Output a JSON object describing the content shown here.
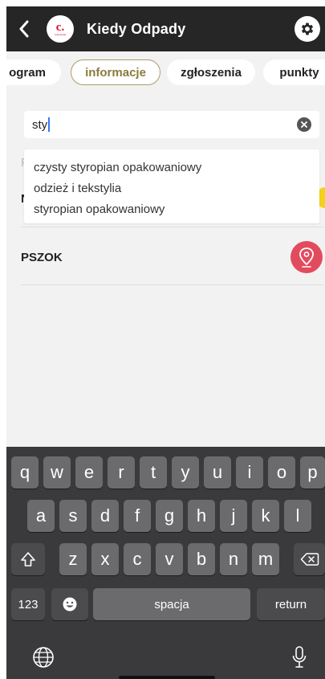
{
  "header": {
    "title": "Kiedy Odpady",
    "logo_text": "c.",
    "logo_sub": "cyklopedia"
  },
  "tabs": [
    {
      "label": "ogram",
      "active": false
    },
    {
      "label": "informacje",
      "active": true
    },
    {
      "label": "zgłoszenia",
      "active": false
    },
    {
      "label": "punkty",
      "active": false
    }
  ],
  "search": {
    "value": "sty"
  },
  "suggestions": [
    "czysty styropian opakowaniowy",
    "odzież i tekstylia",
    "styropian opakowaniowy"
  ],
  "peek": {
    "char_p": "P",
    "char_n": "N"
  },
  "list": {
    "pszok_label": "PSZOK",
    "pin_color": "#e24b5e"
  },
  "keyboard": {
    "row1": [
      "q",
      "w",
      "e",
      "r",
      "t",
      "y",
      "u",
      "i",
      "o",
      "p"
    ],
    "row2": [
      "a",
      "s",
      "d",
      "f",
      "g",
      "h",
      "j",
      "k",
      "l"
    ],
    "row3": [
      "z",
      "x",
      "c",
      "v",
      "b",
      "n",
      "m"
    ],
    "numbers_label": "123",
    "space_label": "spacja",
    "return_label": "return"
  },
  "colors": {
    "header_bg": "#262626",
    "accent_gold": "#8a7a3c",
    "pin": "#e24b5e",
    "peek_yellow": "#f4d21a"
  }
}
